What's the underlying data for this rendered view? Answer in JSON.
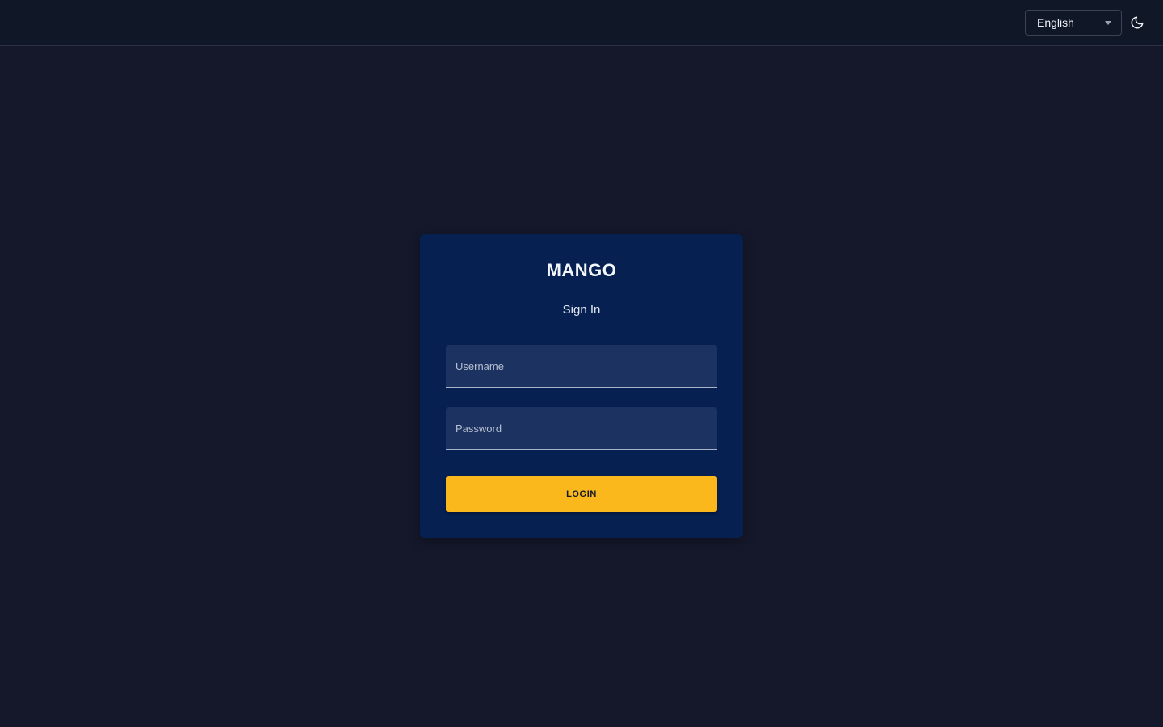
{
  "topbar": {
    "language": {
      "selected": "English"
    },
    "theme_toggle_icon": "moon-icon"
  },
  "login": {
    "app_title": "MANGO",
    "subtitle": "Sign In",
    "username_placeholder": "Username",
    "password_placeholder": "Password",
    "button_label": "LOGIN"
  },
  "colors": {
    "page_background": "#15182b",
    "topbar_background": "#101827",
    "card_background": "#062051",
    "input_background": "#1c3361",
    "accent_button": "#fbb81c"
  }
}
